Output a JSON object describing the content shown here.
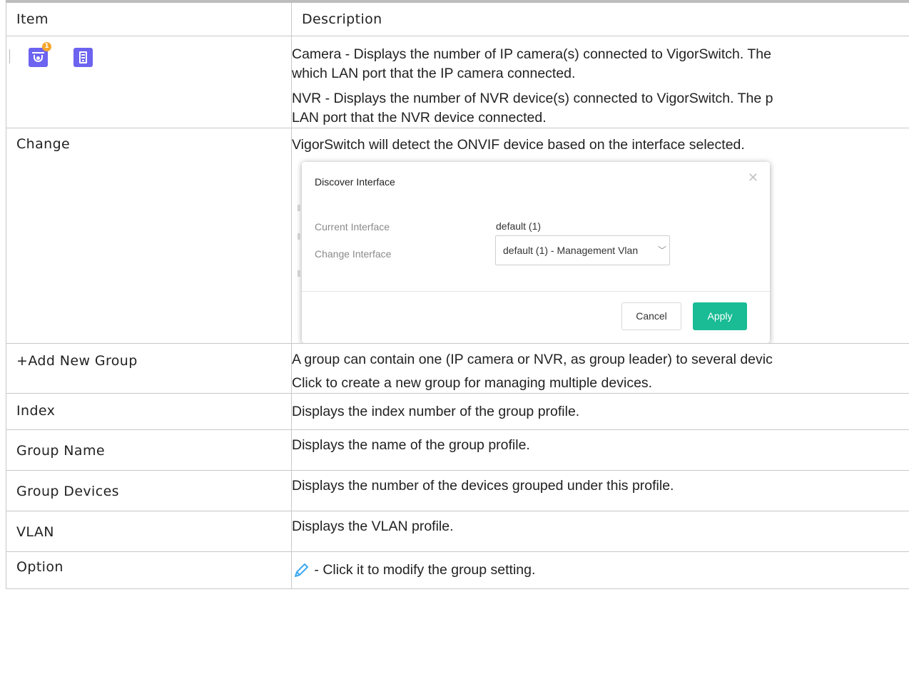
{
  "table": {
    "header": {
      "item": "Item",
      "description": "Description"
    },
    "rows": {
      "icons": {
        "camera_badge": "1",
        "camera_desc_1": "Camera - Displays the number of IP camera(s) connected to VigorSwitch. The",
        "camera_desc_2": "which LAN port that the IP camera connected.",
        "nvr_desc_1": "NVR - Displays the number of NVR device(s) connected to VigorSwitch. The p",
        "nvr_desc_2": "LAN port that the NVR device connected.",
        "icon_color": "#6c63f0",
        "badge_color": "#f4a52b"
      },
      "change": {
        "item": "Change",
        "desc": "VigorSwitch will detect the ONVIF device based on the interface selected.",
        "dialog": {
          "title": "Discover Interface",
          "current_label": "Current Interface",
          "current_value": "default (1)",
          "change_label": "Change Interface",
          "change_value": "default (1) - Management Vlan",
          "cancel_label": "Cancel",
          "apply_label": "Apply",
          "apply_color": "#19bc94"
        }
      },
      "add_group": {
        "item": "+Add New Group",
        "desc_1": "A group can contain one (IP camera or NVR, as group leader) to several devic",
        "desc_2": "Click to create a new group for managing multiple devices."
      },
      "index": {
        "item": "Index",
        "desc": "Displays the index number of the group profile."
      },
      "group_name": {
        "item": "Group Name",
        "desc": "Displays the name of the group profile."
      },
      "group_devices": {
        "item": "Group Devices",
        "desc": "Displays the number of the devices grouped under this profile."
      },
      "vlan": {
        "item": "VLAN",
        "desc": "Displays the VLAN profile."
      },
      "option": {
        "item": "Option",
        "desc": " - Click it to modify the group setting.",
        "pencil_color": "#3ea8f2"
      }
    }
  }
}
